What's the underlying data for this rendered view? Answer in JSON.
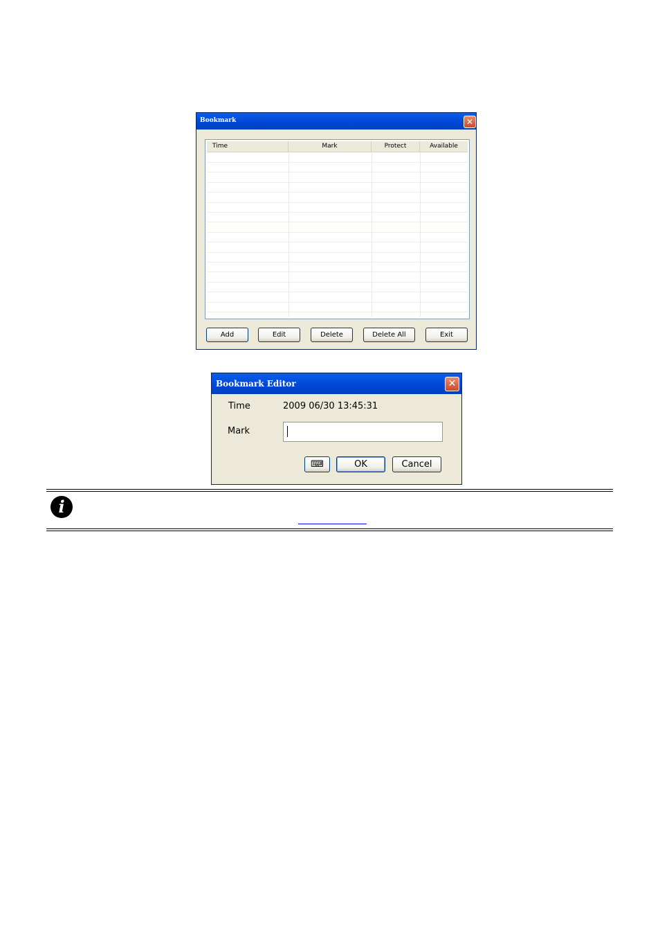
{
  "bookmark_window": {
    "title": "Bookmark",
    "close_glyph": "✕",
    "columns": [
      "Time",
      "Mark",
      "Protect",
      "Available"
    ],
    "buttons": {
      "add": "Add",
      "edit": "Edit",
      "delete": "Delete",
      "delete_all": "Delete All",
      "exit": "Exit"
    }
  },
  "editor_window": {
    "title": "Bookmark Editor",
    "close_glyph": "✕",
    "time_label": "Time",
    "time_value": "2009 06/30 13:45:31",
    "mark_label": "Mark",
    "mark_value": "",
    "keyboard_glyph": "⌨",
    "ok_label": "OK",
    "cancel_label": "Cancel"
  },
  "note": {
    "icon_glyph": "i"
  },
  "icons": {
    "close": "close-icon",
    "keyboard": "keyboard-icon",
    "info": "info-icon"
  }
}
